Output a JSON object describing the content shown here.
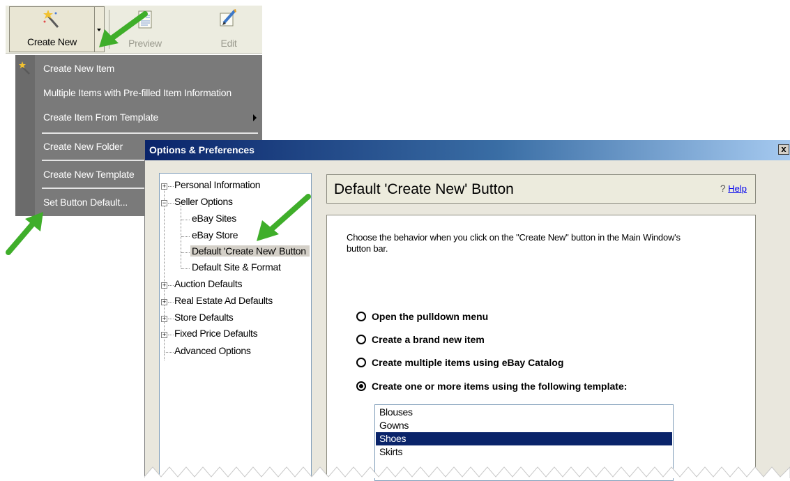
{
  "toolbar": {
    "create_new_label": "Create New",
    "preview_label": "Preview",
    "edit_label": "Edit"
  },
  "menu": {
    "items": [
      {
        "label": "Create New Item"
      },
      {
        "label": "Multiple Items with Pre-filled Item Information"
      },
      {
        "label": "Create Item From Template"
      },
      {
        "label": "Create New Folder"
      },
      {
        "label": "Create New Template"
      },
      {
        "label": "Set Button Default..."
      }
    ]
  },
  "dialog": {
    "title": "Options & Preferences",
    "close_glyph": "x",
    "tree": {
      "items": [
        {
          "label": "Personal Information"
        },
        {
          "label": "Seller Options"
        },
        {
          "label": "eBay Sites"
        },
        {
          "label": "eBay Store"
        },
        {
          "label": "Default 'Create New' Button"
        },
        {
          "label": "Default Site & Format"
        },
        {
          "label": "Auction Defaults"
        },
        {
          "label": "Real Estate Ad Defaults"
        },
        {
          "label": "Store Defaults"
        },
        {
          "label": "Fixed Price Defaults"
        },
        {
          "label": "Advanced Options"
        }
      ]
    },
    "panel": {
      "title": "Default 'Create New' Button",
      "help_label": "Help",
      "description": "Choose the behavior when you click on the \"Create New\" button in the Main Window's button bar.",
      "options": [
        {
          "label": "Open the pulldown menu",
          "selected": false
        },
        {
          "label": "Create a brand new item",
          "selected": false
        },
        {
          "label": "Create multiple items using eBay Catalog",
          "selected": false
        },
        {
          "label": "Create one or more items using the following template:",
          "selected": true
        }
      ],
      "templates": [
        "Blouses",
        "Gowns",
        "Shoes",
        "Skirts"
      ],
      "selected_template": "Shoes"
    }
  },
  "colors": {
    "arrow": "#3fae2a",
    "titlebar": "#0a246a",
    "menu_bg": "#7a7a7a",
    "selection": "#0a246a"
  }
}
